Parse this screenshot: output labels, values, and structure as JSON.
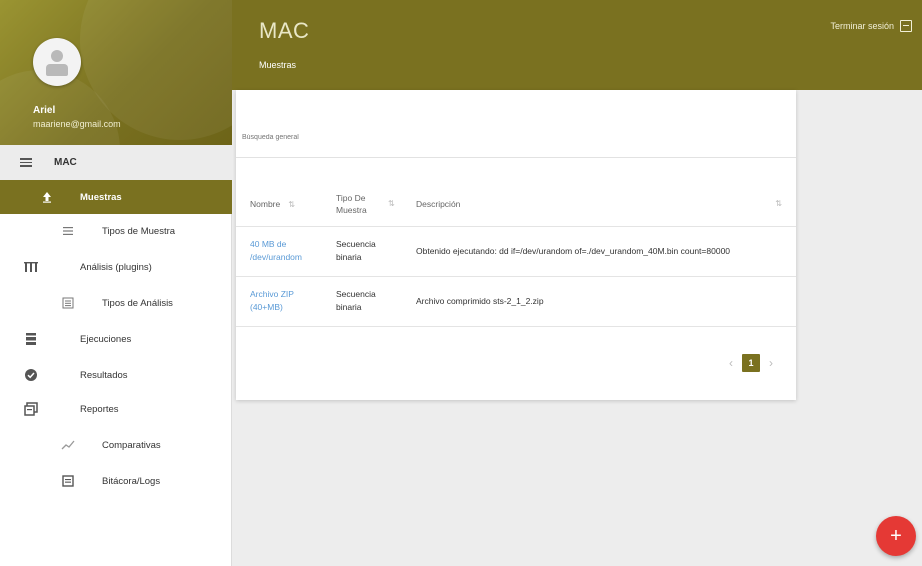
{
  "user": {
    "name": "Ariel",
    "email": "maariene@gmail.com"
  },
  "menu_header": {
    "title": "MAC"
  },
  "nav": {
    "items": [
      {
        "label": "Muestras",
        "icon": "upload-arrow-icon",
        "active": true
      },
      {
        "label": "Tipos de Muestra",
        "icon": "list-icon"
      },
      {
        "label": "Análisis (plugins)",
        "icon": "grid-icon"
      },
      {
        "label": "Tipos de Análisis",
        "icon": "list-icon"
      },
      {
        "label": "Ejecuciones",
        "icon": "stack-icon"
      },
      {
        "label": "Resultados",
        "icon": "check-circle-icon"
      },
      {
        "label": "Reportes",
        "icon": "report-icon"
      },
      {
        "label": "Comparativas",
        "icon": "trending-icon"
      },
      {
        "label": "Bitácora/Logs",
        "icon": "log-icon"
      }
    ]
  },
  "header": {
    "title": "MAC",
    "subtitle": "Muestras",
    "logout": "Terminar sesión"
  },
  "search": {
    "placeholder": "Búsqueda general"
  },
  "table": {
    "columns": [
      "Nombre",
      "Tipo De Muestra",
      "Descripción"
    ],
    "rows": [
      {
        "name": "40 MB de /dev/urandom",
        "type": "Secuencia binaria",
        "description": "Obtenido ejecutando: dd if=/dev/urandom of=./dev_urandom_40M.bin count=80000"
      },
      {
        "name": "Archivo ZIP (40+MB)",
        "type": "Secuencia binaria",
        "description": "Archivo comprimido sts-2_1_2.zip"
      }
    ]
  },
  "pagination": {
    "current": "1"
  },
  "fab": {
    "label": "+"
  },
  "colors": {
    "primary": "#7a7120",
    "accent": "#e53935",
    "link": "#5a9ad6"
  }
}
